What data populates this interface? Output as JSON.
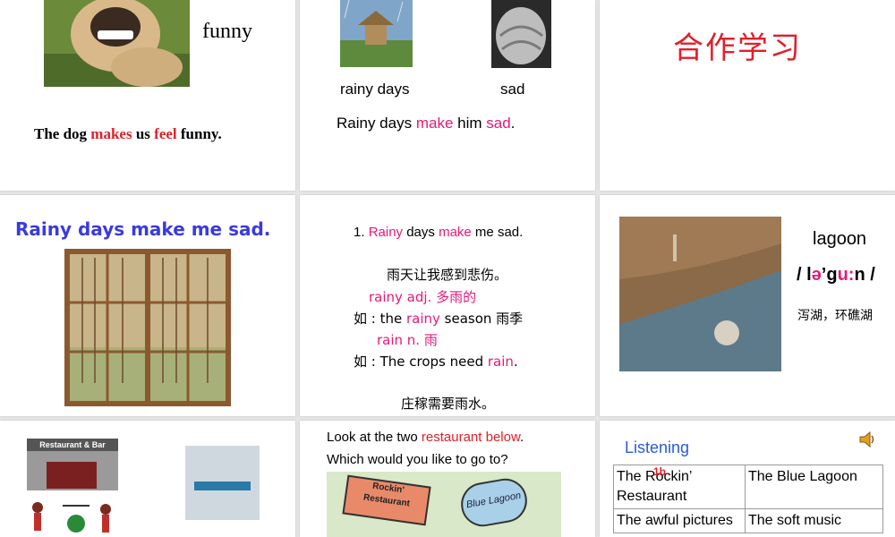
{
  "slide1": {
    "word": "funny",
    "sentence": {
      "p1": "The dog ",
      "p2": "makes",
      "p3": " us ",
      "p4": "feel",
      "p5": " funny."
    }
  },
  "slide2": {
    "label_left": "rainy days",
    "label_right": "sad",
    "sentence": {
      "p1": "Rainy days ",
      "p2": "make",
      "p3": " him ",
      "p4": "sad",
      "p5": "."
    }
  },
  "slide3": {
    "title": "合作学习"
  },
  "slide4": {
    "title": "Rainy days make me sad."
  },
  "slide5": {
    "line1": {
      "p1": "1. ",
      "p2": "Rainy",
      "p3": " days ",
      "p4": "make",
      "p5": " me sad."
    },
    "line2": "雨天让我感到悲伤。",
    "line3": "rainy  adj.  多雨的",
    "line4": {
      "p1": "如 : the ",
      "p2": "rainy",
      "p3": " season  雨季"
    },
    "line5": "rain n.   雨",
    "line6": {
      "p1": "如 : The crops need ",
      "p2": "rain",
      "p3": "."
    },
    "line7": "庄稼需要雨水。"
  },
  "slide6": {
    "word": "lagoon",
    "phonetic": {
      "p1": "/ l",
      "p2": "ə",
      "p3": "’g",
      "p4": "u:",
      "p5": "n /"
    },
    "meaning": "泻湖，环礁湖"
  },
  "slide7": {
    "sign": "Restaurant & Bar"
  },
  "slide8": {
    "line1": {
      "p1": "Look at the two ",
      "p2": "restaurant below",
      "p3": "."
    },
    "line2": "Which would you like to go to?",
    "sign_rockin": "Rockin' Restaurant",
    "sign_blue": "Blue Lagoon"
  },
  "slide9": {
    "title": "Listening",
    "badge": "1b",
    "table": [
      [
        "The Rockin’ Restaurant",
        "The Blue Lagoon"
      ],
      [
        "The awful pictures",
        "The soft music"
      ]
    ]
  },
  "colors": {
    "red": "#e0202a",
    "pink": "#e6197a",
    "blue_title": "#3a3adf",
    "listening_blue": "#2a5bd7"
  },
  "icons": [
    "speaker-icon"
  ]
}
